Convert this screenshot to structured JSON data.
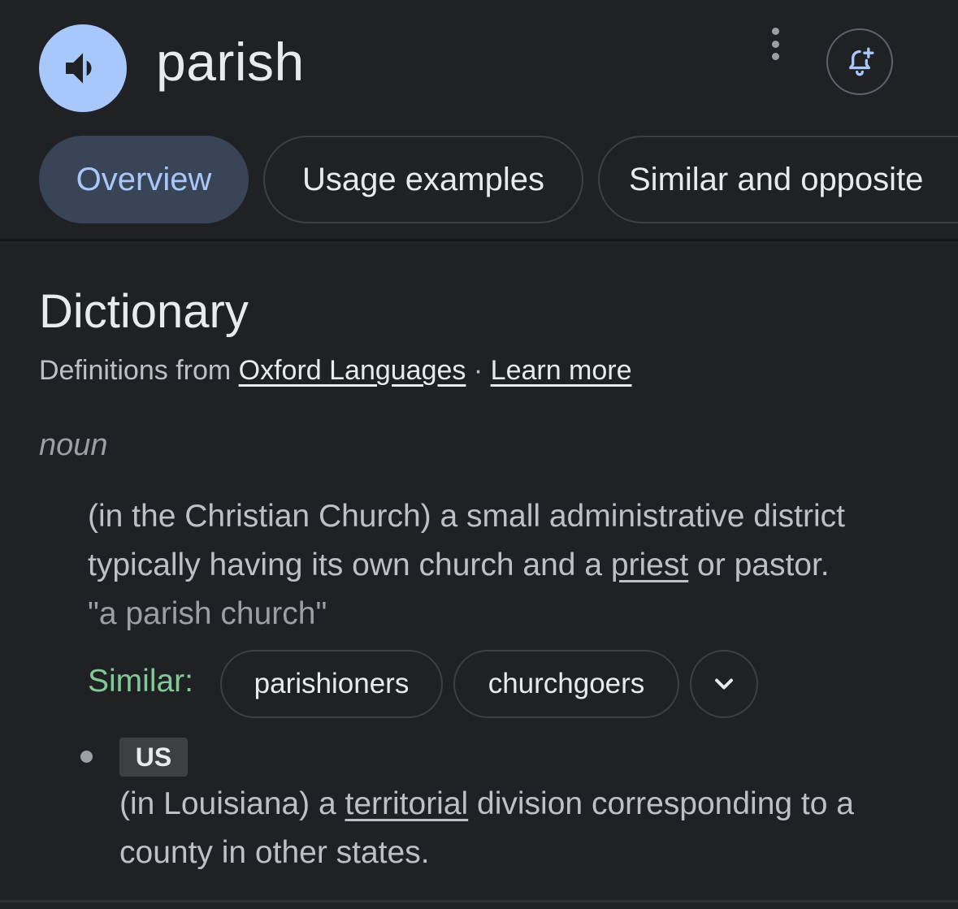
{
  "header": {
    "word": "parish",
    "speaker_icon": "volume-up-icon",
    "more_icon": "more-vert-icon",
    "bell_icon": "bell-plus-icon"
  },
  "tabs": [
    {
      "label": "Overview",
      "active": true
    },
    {
      "label": "Usage examples",
      "active": false
    },
    {
      "label": "Similar and opposite",
      "active": false
    }
  ],
  "dictionary": {
    "title": "Dictionary",
    "source_prefix": "Definitions from",
    "source_link": "Oxford Languages",
    "separator": "·",
    "learn_more": "Learn more",
    "part_of_speech": "noun",
    "definition1": {
      "before_link": "(in the Christian Church) a small administrative district typically having its own church and a ",
      "link": "priest",
      "after_link": " or pastor.",
      "example": "\"a parish church\""
    },
    "similar": {
      "label": "Similar:",
      "chips": [
        "parishioners",
        "churchgoers"
      ],
      "expand_icon": "chevron-down-icon"
    },
    "definition2": {
      "region": "US",
      "before_link": "(in Louisiana) a ",
      "link": "territorial",
      "after_link": " division corresponding to a county in other states."
    }
  },
  "colors": {
    "background": "#202124",
    "accent": "#a8c7fa",
    "similar_label": "#81c995",
    "active_tab": "#394457"
  }
}
